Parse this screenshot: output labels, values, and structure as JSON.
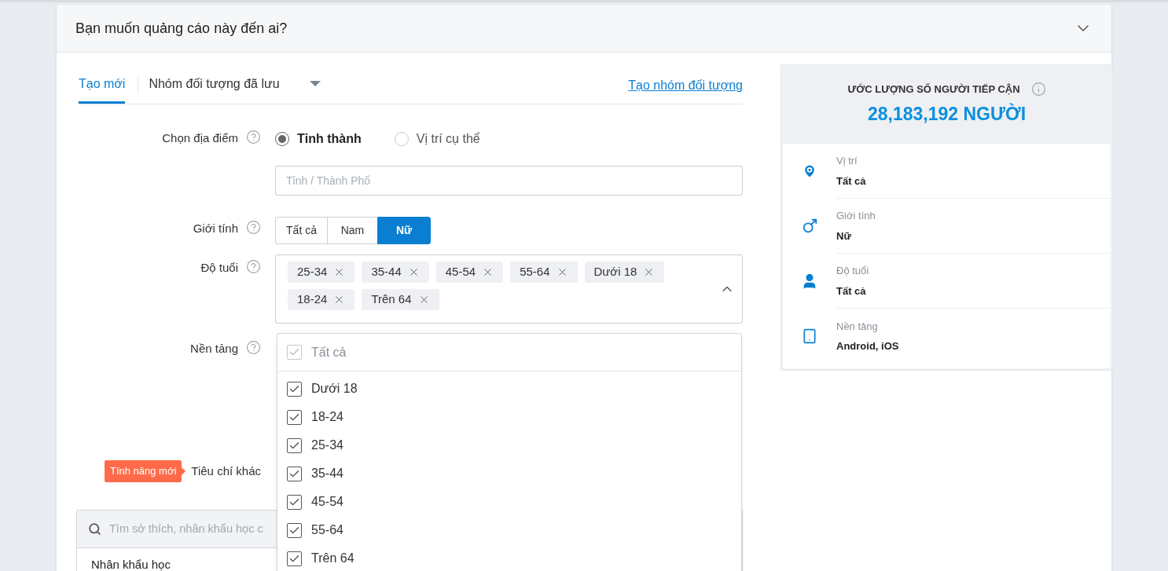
{
  "section": {
    "title": "Bạn muốn quảng cáo này đến ai?",
    "expanded": true
  },
  "tabs": [
    {
      "label": "Tạo mới",
      "selected": true,
      "kind": "tab"
    },
    {
      "label": "Nhóm đối tượng đã lưu",
      "selected": false,
      "kind": "dropdown"
    }
  ],
  "create_link": "Tạo nhóm đối tượng",
  "location": {
    "label": "Chọn địa điểm",
    "options": [
      {
        "label": "Tỉnh thành",
        "selected": true
      },
      {
        "label": "Vị trí cụ thể",
        "selected": false
      }
    ],
    "placeholder": "Tỉnh / Thành Phố"
  },
  "gender": {
    "label": "Giới tính",
    "options": [
      {
        "label": "Tất cả",
        "selected": false
      },
      {
        "label": "Nam",
        "selected": false
      },
      {
        "label": "Nữ",
        "selected": true
      }
    ]
  },
  "age": {
    "label": "Độ tuổi",
    "expanded": true,
    "tags": [
      "25-34",
      "35-44",
      "45-54",
      "55-64",
      "Dưới 18",
      "18-24",
      "Trên 64"
    ],
    "all_option": {
      "label": "Tất cả",
      "checked": true,
      "disabled": true
    },
    "options": [
      {
        "label": "Dưới 18",
        "checked": true
      },
      {
        "label": "18-24",
        "checked": true
      },
      {
        "label": "25-34",
        "checked": true
      },
      {
        "label": "35-44",
        "checked": true
      },
      {
        "label": "45-54",
        "checked": true
      },
      {
        "label": "55-64",
        "checked": true
      },
      {
        "label": "Trên 64",
        "checked": true
      }
    ]
  },
  "platform": {
    "label": "Nền tảng"
  },
  "other": {
    "badge": "Tính năng mới",
    "label": "Tiêu chí khác"
  },
  "search": {
    "placeholder": "Tìm sở thích, nhân khẩu học c",
    "category": "Nhân khẩu học"
  },
  "estimate": {
    "title": "ƯỚC LƯỢNG SỐ NGƯỜI TIẾP CẬN",
    "value": "28,183,192 NGƯỜI",
    "items": [
      {
        "kind": "location",
        "label": "Vị trí",
        "value": "Tất cả"
      },
      {
        "kind": "gender",
        "label": "Giới tính",
        "value": "Nữ"
      },
      {
        "kind": "age",
        "label": "Độ tuổi",
        "value": "Tất cả"
      },
      {
        "kind": "platform",
        "label": "Nền tảng",
        "value": "Android, iOS"
      }
    ]
  }
}
